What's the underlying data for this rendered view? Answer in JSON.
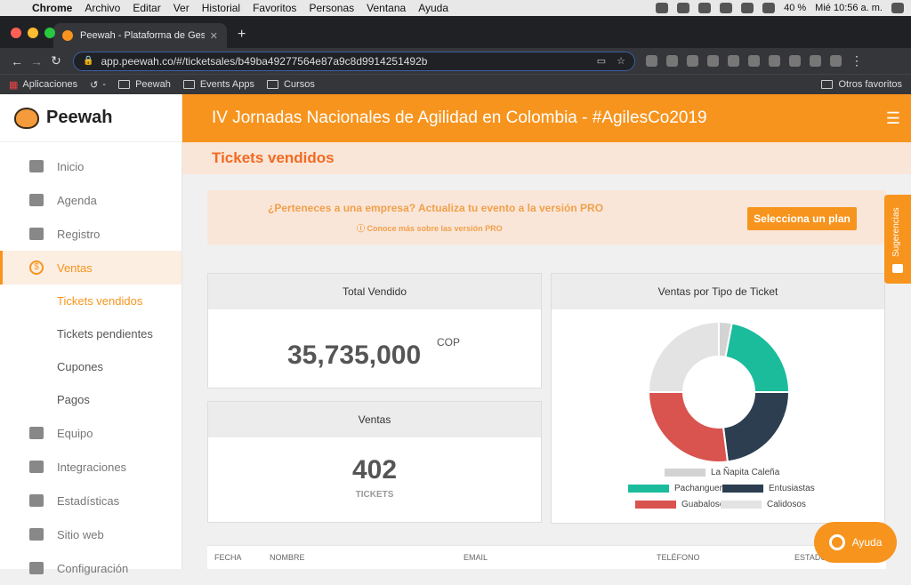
{
  "menubar": {
    "apple": "",
    "items": [
      "Chrome",
      "Archivo",
      "Editar",
      "Ver",
      "Historial",
      "Favoritos",
      "Personas",
      "Ventana",
      "Ayuda"
    ],
    "battery": "40 %",
    "clock": "Mié 10:56 a. m."
  },
  "browser": {
    "tab_title": "Peewah - Plataforma de Gestió",
    "url": "app.peewah.co/#/ticketsales/b49ba49277564e87a9c8d9914251492b",
    "bookmarks": [
      "Aplicaciones",
      "-",
      "Peewah",
      "Events Apps",
      "Cursos"
    ],
    "other_bookmarks": "Otros favoritos"
  },
  "brand": {
    "name": "Peewah",
    "accent": "#f7941d"
  },
  "sidebar": {
    "items": [
      {
        "label": "Inicio",
        "icon": "dashboard-icon"
      },
      {
        "label": "Agenda",
        "icon": "calendar-icon"
      },
      {
        "label": "Registro",
        "icon": "ticket-icon"
      },
      {
        "label": "Ventas",
        "icon": "dollar-icon"
      },
      {
        "label": "Equipo",
        "icon": "people-icon"
      },
      {
        "label": "Integraciones",
        "icon": "key-icon"
      },
      {
        "label": "Estadísticas",
        "icon": "chart-line-icon"
      },
      {
        "label": "Sitio web",
        "icon": "globe-icon"
      },
      {
        "label": "Configuración",
        "icon": "gear-icon"
      }
    ],
    "ventas_sub": [
      "Tickets vendidos",
      "Tickets pendientes",
      "Cupones",
      "Pagos"
    ]
  },
  "header": {
    "title": "IV Jornadas Nacionales de Agilidad en Colombia - #AgilesCo2019"
  },
  "page": {
    "title": "Tickets vendidos"
  },
  "promo": {
    "question": "¿Perteneces a una empresa? Actualiza tu evento a la versión PRO",
    "more": "Conoce más sobre las versión PRO",
    "button": "Selecciona un plan"
  },
  "total": {
    "title": "Total Vendido",
    "value": "35,735,000",
    "currency": "COP"
  },
  "ventas": {
    "title": "Ventas",
    "value": "402",
    "label": "TICKETS"
  },
  "chart_title": "Ventas por Tipo de Ticket",
  "chart_data": {
    "type": "pie",
    "title": "Ventas por Tipo de Ticket",
    "categories": [
      "La Ñapita Caleña",
      "Pachangueros",
      "Entusiastas",
      "Guabalosos",
      "Calidosos"
    ],
    "values": [
      3,
      22,
      23,
      27,
      25
    ],
    "colors": [
      "#d3d3d3",
      "#1abc9c",
      "#2c3e50",
      "#d9534f",
      "#e3e3e3"
    ],
    "legend": "bottom"
  },
  "table": {
    "headers": [
      "FECHA",
      "NOMBRE",
      "EMAIL",
      "TELÉFONO",
      "ESTADO"
    ]
  },
  "suggestions": "Sugerencias",
  "help": "Ayuda"
}
